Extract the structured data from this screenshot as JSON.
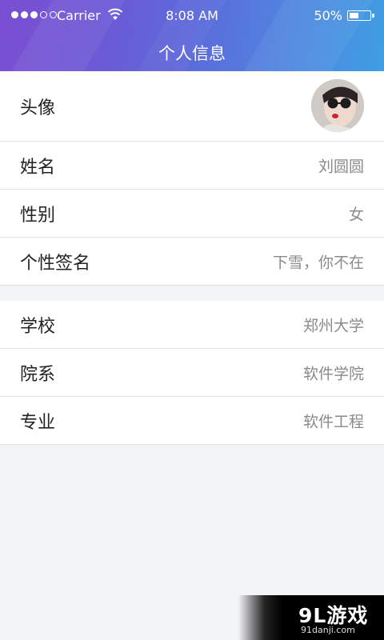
{
  "status_bar": {
    "carrier": "Carrier",
    "time": "8:08 AM",
    "battery": "50%",
    "signal_bars_filled": 3,
    "signal_bars_total": 5,
    "battery_level": 0.5
  },
  "header": {
    "title": "个人信息"
  },
  "profile": {
    "avatar_label": "头像",
    "rows": [
      {
        "label": "姓名",
        "value": "刘圆圆"
      },
      {
        "label": "性别",
        "value": "女"
      },
      {
        "label": "个性签名",
        "value": "下雪，你不在"
      }
    ]
  },
  "school": {
    "rows": [
      {
        "label": "学校",
        "value": "郑州大学"
      },
      {
        "label": "院系",
        "value": "软件学院"
      },
      {
        "label": "专业",
        "value": "软件工程"
      }
    ]
  },
  "watermark": {
    "logo": "9L游戏",
    "url": "91danji.com"
  },
  "colors": {
    "header_gradient_start": "#7b4fd2",
    "header_gradient_end": "#3f9ee3",
    "background": "#f2f3f5",
    "value_text": "#8a8a8a"
  }
}
